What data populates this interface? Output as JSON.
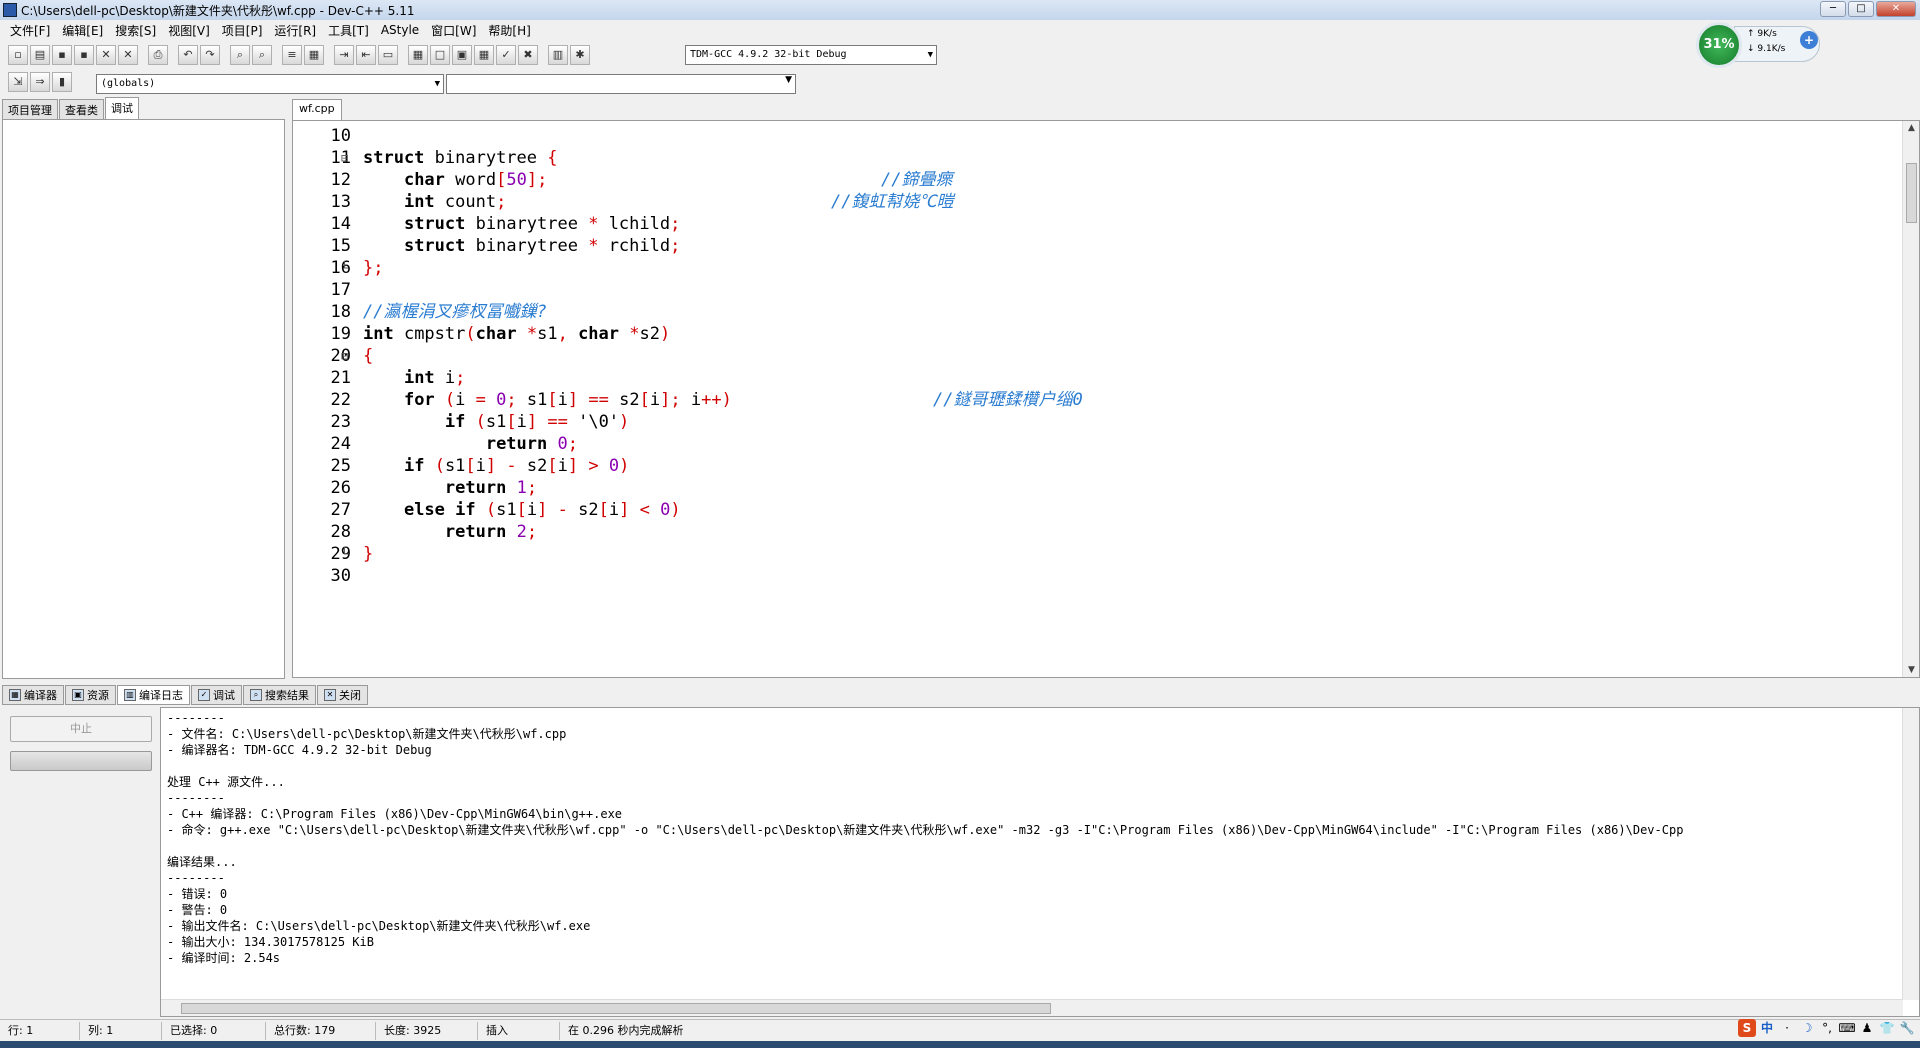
{
  "window": {
    "title": "C:\\Users\\dell-pc\\Desktop\\新建文件夹\\代秋彤\\wf.cpp - Dev-C++ 5.11",
    "min": "─",
    "max": "□",
    "close": "✕"
  },
  "menu": [
    "文件[F]",
    "编辑[E]",
    "搜索[S]",
    "视图[V]",
    "项目[P]",
    "运行[R]",
    "工具[T]",
    "AStyle",
    "窗口[W]",
    "帮助[H]"
  ],
  "toolbar": {
    "compiler": "TDM-GCC 4.9.2 32-bit Debug",
    "scope": "(globals)"
  },
  "widget": {
    "percent": "31%",
    "up": "9K/s",
    "down": "9.1K/s",
    "plus": "+"
  },
  "left_tabs": [
    "项目管理",
    "查看类",
    "调试"
  ],
  "editor_tab": "wf.cpp",
  "code": [
    {
      "n": "10",
      "fold": "",
      "text": ""
    },
    {
      "n": "11",
      "fold": "⊟",
      "text": "struct binarytree {"
    },
    {
      "n": "12",
      "fold": "",
      "text": "    char word[50];"
    },
    {
      "n": "13",
      "fold": "",
      "text": "    int count;"
    },
    {
      "n": "14",
      "fold": "",
      "text": "    struct binarytree * lchild;"
    },
    {
      "n": "15",
      "fold": "",
      "text": "    struct binarytree * rchild;"
    },
    {
      "n": "16",
      "fold": "└",
      "text": "};"
    },
    {
      "n": "17",
      "fold": "",
      "text": ""
    },
    {
      "n": "18",
      "fold": "",
      "text": ""
    },
    {
      "n": "19",
      "fold": "",
      "text": "int cmpstr(char *s1, char *s2)"
    },
    {
      "n": "20",
      "fold": "⊟",
      "text": "{"
    },
    {
      "n": "21",
      "fold": "",
      "text": "    int i;"
    },
    {
      "n": "22",
      "fold": "",
      "text": "    for (i = 0; s1[i] == s2[i]; i++)"
    },
    {
      "n": "23",
      "fold": "",
      "text": "        if (s1[i] == '\\0')"
    },
    {
      "n": "24",
      "fold": "",
      "text": "            return 0;"
    },
    {
      "n": "25",
      "fold": "",
      "text": "    if (s1[i] - s2[i] > 0)"
    },
    {
      "n": "26",
      "fold": "",
      "text": "        return 1;"
    },
    {
      "n": "27",
      "fold": "",
      "text": "    else if (s1[i] - s2[i] < 0)"
    },
    {
      "n": "28",
      "fold": "",
      "text": "        return 2;"
    },
    {
      "n": "29",
      "fold": "└",
      "text": "}"
    },
    {
      "n": "30",
      "fold": "",
      "text": ""
    }
  ],
  "comments": {
    "c12": "//鍗曡瘝",
    "c13": "//鍑虹幇娆℃暟",
    "c18": "//瀛楃涓叉瘮杈冨嚱鏁?",
    "c22": "//鐩哥瓑鍒欑户缁0"
  },
  "bottom_tabs": [
    "编译器",
    "资源",
    "编译日志",
    "调试",
    "搜索结果",
    "关闭"
  ],
  "stop_label": "中止",
  "log": [
    "--------",
    "- 文件名: C:\\Users\\dell-pc\\Desktop\\新建文件夹\\代秋彤\\wf.cpp",
    "- 编译器名: TDM-GCC 4.9.2 32-bit Debug",
    "",
    "处理 C++ 源文件...",
    "--------",
    "- C++ 编译器: C:\\Program Files (x86)\\Dev-Cpp\\MinGW64\\bin\\g++.exe",
    "- 命令: g++.exe \"C:\\Users\\dell-pc\\Desktop\\新建文件夹\\代秋彤\\wf.cpp\" -o \"C:\\Users\\dell-pc\\Desktop\\新建文件夹\\代秋彤\\wf.exe\" -m32 -g3 -I\"C:\\Program Files (x86)\\Dev-Cpp\\MinGW64\\include\" -I\"C:\\Program Files (x86)\\Dev-Cpp",
    "",
    "编译结果...",
    "--------",
    "- 错误: 0",
    "- 警告: 0",
    "- 输出文件名: C:\\Users\\dell-pc\\Desktop\\新建文件夹\\代秋彤\\wf.exe",
    "- 输出大小: 134.3017578125 KiB",
    "- 编译时间: 2.54s"
  ],
  "status": {
    "row_label": "行:",
    "row": "1",
    "col_label": "列:",
    "col": "1",
    "sel_label": "已选择:",
    "sel": "0",
    "lines_label": "总行数:",
    "lines": "179",
    "len_label": "长度:",
    "len": "3925",
    "mode": "插入",
    "parse": "在 0.296 秒内完成解析"
  },
  "ime": [
    "S",
    "中",
    "·",
    "☽",
    "°,",
    "⌨",
    "♟",
    "👕",
    "🔧"
  ]
}
